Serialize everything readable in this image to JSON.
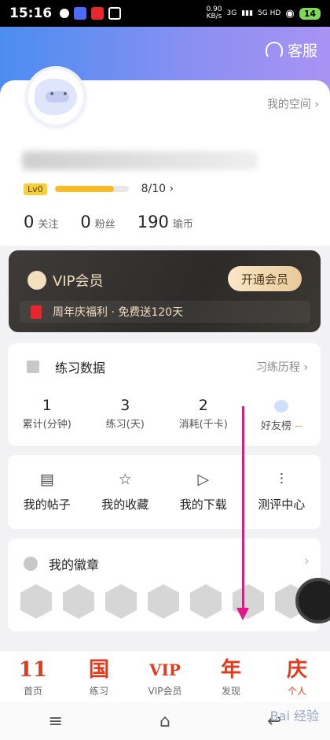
{
  "status_bar": {
    "time": "15:16",
    "speed": "0.90\nKB/s",
    "net": "3G",
    "net2": "5G HD",
    "battery": "14"
  },
  "header": {
    "service_label": "客服"
  },
  "profile": {
    "my_space": "我的空间 ›",
    "level_badge": "Lv0",
    "level_progress": 0.8,
    "level_text": "8/10 ›"
  },
  "stats": [
    {
      "num": "0",
      "label": "关注"
    },
    {
      "num": "0",
      "label": "粉丝"
    },
    {
      "num": "190",
      "label": "瑜币"
    }
  ],
  "vip": {
    "title": "VIP会员",
    "button": "开通会员",
    "promo": "周年庆福利 · 免费送120天"
  },
  "practice": {
    "title": "练习数据",
    "history": "习练历程 ›",
    "items": [
      {
        "num": "1",
        "label": "累计(分钟)"
      },
      {
        "num": "3",
        "label": "练习(天)"
      },
      {
        "num": "2",
        "label": "消耗(千卡)"
      }
    ],
    "friends_label": "好友榜",
    "friends_dash": "--"
  },
  "actions": [
    {
      "label": "我的帖子",
      "icon": "post-icon"
    },
    {
      "label": "我的收藏",
      "icon": "star-icon"
    },
    {
      "label": "我的下载",
      "icon": "play-icon"
    },
    {
      "label": "测评中心",
      "icon": "bars-icon"
    }
  ],
  "badges": {
    "title": "我的徽章",
    "count": 7
  },
  "tabs": [
    {
      "icon_text": "11",
      "label": "首页"
    },
    {
      "icon_text": "国",
      "label": "练习"
    },
    {
      "icon_text": "VIP",
      "label": "VIP会员"
    },
    {
      "icon_text": "年",
      "label": "发现"
    },
    {
      "icon_text": "庆",
      "label": "个人"
    }
  ],
  "navbar": {
    "menu": "≡",
    "home": "⌂",
    "back": "↩"
  },
  "watermark": "Bai 经验"
}
